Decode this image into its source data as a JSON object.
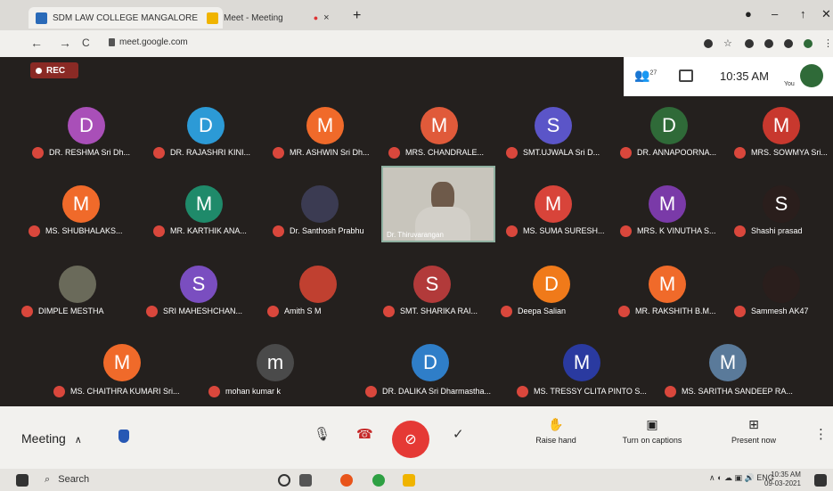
{
  "browser": {
    "tabs": [
      {
        "label": "SDM LAW COLLEGE MANGALORE",
        "close": "×"
      },
      {
        "label": "Meet - Meeting",
        "close": "×"
      }
    ],
    "new_tab": "+",
    "url": "meet.google.com",
    "back": "←",
    "forward": "→",
    "reload": "C"
  },
  "meeting": {
    "rec_label": "REC",
    "participant_count": "27",
    "clock": "10:35 AM",
    "self_label": "You",
    "participants": [
      {
        "initial": "D",
        "name": "DR. RESHMA Sri Dh...",
        "color": "#a94fb8"
      },
      {
        "initial": "D",
        "name": "DR. RAJASHRI KINI...",
        "color": "#2c9ad6"
      },
      {
        "initial": "M",
        "name": "MR. ASHWIN Sri Dh...",
        "color": "#f06a2a"
      },
      {
        "initial": "M",
        "name": "MRS. CHANDRALE...",
        "color": "#e05a3a"
      },
      {
        "initial": "S",
        "name": "SMT.UJWALA Sri D...",
        "color": "#5b55c8"
      },
      {
        "initial": "D",
        "name": "DR. ANNAPOORNA...",
        "color": "#2f6a38"
      },
      {
        "initial": "M",
        "name": "MRS. SOWMYA Sri...",
        "color": "#c8382e"
      },
      {
        "initial": "M",
        "name": "MS. SHUBHALAKS...",
        "color": "#f06a2a"
      },
      {
        "initial": "M",
        "name": "MR. KARTHIK ANA...",
        "color": "#1f8a6a"
      },
      {
        "initial": "",
        "name": "Dr. Santhosh Prabhu",
        "color": "#3b3b52"
      },
      {
        "initial": "M",
        "name": "MS. SUMA SURESH...",
        "color": "#d8443a"
      },
      {
        "initial": "M",
        "name": "MRS. K VINUTHA S...",
        "color": "#7a3aa8"
      },
      {
        "initial": "S",
        "name": "Shashi prasad",
        "color": "#2a1e1c"
      },
      {
        "initial": "",
        "name": "DIMPLE MESTHA",
        "color": "#6a6a5a"
      },
      {
        "initial": "S",
        "name": "SRI MAHESHCHAN...",
        "color": "#7a4ec0"
      },
      {
        "initial": "",
        "name": "Amith S M",
        "color": "#c04030"
      },
      {
        "initial": "S",
        "name": "SMT. SHARIKA RAI...",
        "color": "#b23a3a"
      },
      {
        "initial": "D",
        "name": "Deepa Salian",
        "color": "#f07a1a"
      },
      {
        "initial": "M",
        "name": "MR. RAKSHITH B.M...",
        "color": "#f06a2a"
      },
      {
        "initial": "",
        "name": "Sammesh AK47",
        "color": "#2a1e1c"
      },
      {
        "initial": "M",
        "name": "MS. CHAITHRA KUMARI Sri...",
        "color": "#f06a2a"
      },
      {
        "initial": "m",
        "name": "mohan kumar k",
        "color": "#4a4a4a"
      },
      {
        "initial": "D",
        "name": "DR. DALIKA Sri Dharmastha...",
        "color": "#2f7ec8"
      },
      {
        "initial": "M",
        "name": "MS. TRESSY CLITA PINTO S...",
        "color": "#2a3aa0"
      },
      {
        "initial": "M",
        "name": "MS. SARITHA SANDEEP RA...",
        "color": "#5a7a9a"
      }
    ],
    "video_name": "Dr. Thiruvarangan"
  },
  "bottom": {
    "meeting_label": "Meeting",
    "raise_hand": "Raise hand",
    "captions": "Turn on captions",
    "present": "Present now",
    "more": "⋮"
  },
  "taskbar": {
    "search": "Search",
    "time": "10:35 AM",
    "date": "09-03-2021"
  }
}
